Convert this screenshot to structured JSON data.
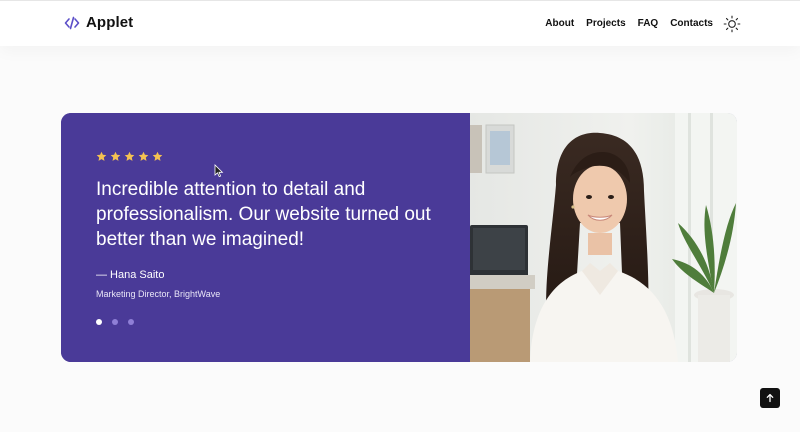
{
  "brand": {
    "name": "Applet",
    "accent": "#5b4ec8"
  },
  "nav": {
    "items": [
      "About",
      "Projects",
      "FAQ",
      "Contacts"
    ],
    "theme_icon": "sun-icon"
  },
  "testimonial": {
    "rating": 5,
    "quote": "Incredible attention to detail and professionalism. Our website turned out better than we imagined!",
    "author": "— Hana Saito",
    "role": "Marketing Director, BrightWave",
    "slides": 3,
    "active_slide": 1,
    "card_color": "#4a3a98",
    "star_color": "#f4c152",
    "photo_icon": "person-photo"
  },
  "scroll_top": {
    "icon": "arrow-up-icon"
  }
}
